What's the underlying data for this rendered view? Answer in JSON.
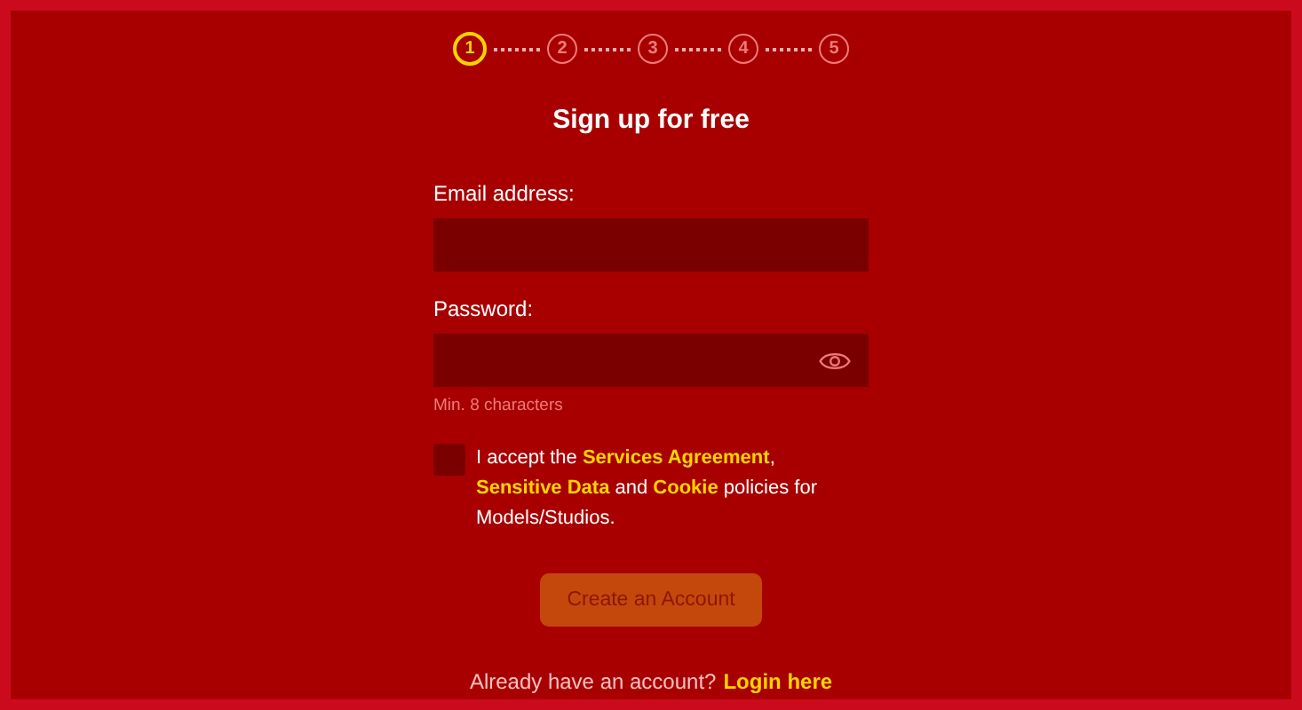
{
  "steps": [
    {
      "label": "1",
      "selected": true
    },
    {
      "label": "2",
      "selected": false
    },
    {
      "label": "3",
      "selected": false
    },
    {
      "label": "4",
      "selected": false
    },
    {
      "label": "5",
      "selected": false
    }
  ],
  "title": "Sign up for free",
  "email": {
    "label": "Email address:"
  },
  "password": {
    "label": "Password:",
    "hint": "Min. 8 characters"
  },
  "consent": {
    "checked": false,
    "parts": [
      {
        "kind": "text",
        "text": "I accept the "
      },
      {
        "kind": "link",
        "text": "Services Agreement"
      },
      {
        "kind": "text",
        "text": ", "
      },
      {
        "kind": "link",
        "text": "Sensitive Data"
      },
      {
        "kind": "text",
        "text": " and "
      },
      {
        "kind": "link",
        "text": "Cookie"
      },
      {
        "kind": "text",
        "text": " policies for Models/Studios."
      }
    ]
  },
  "submit": {
    "label": "Create an Account",
    "disabled": true
  },
  "login": {
    "prompt": "Already have an account?",
    "link": "Login here"
  }
}
